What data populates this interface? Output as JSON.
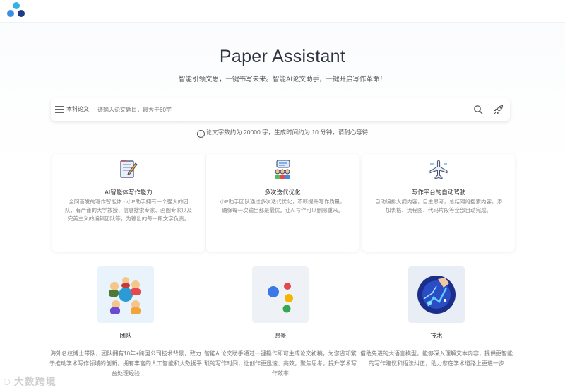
{
  "header": {
    "logo_colors": [
      "#2fb3e8",
      "#3a8ee6",
      "#1f3a8a"
    ]
  },
  "hero": {
    "title": "Paper Assistant",
    "subtitle": "智能引领文思，一键书写未来。智能AI论文助手，一键开启写作革命！"
  },
  "search": {
    "type_label": "本科论文",
    "placeholder": "请输入论文题目，最大于60字",
    "search_icon": "search-icon",
    "submit_icon": "rocket-icon"
  },
  "notice": {
    "icon": "info-icon",
    "text": "论文字数约为 20000 字，生成时间约为 10 分钟，请耐心等待"
  },
  "cards": [
    {
      "icon": "writing-icon",
      "title": "AI智能体写作能力",
      "desc": "全网首发的写作智能体 - 小P助手拥有一个强大的团队，有严谨的大学教授、信息搜索专家、画图专家以及完美主义的编辑团队等，为输出的每一段文字负责。"
    },
    {
      "icon": "team-chat-icon",
      "title": "多次迭代优化",
      "desc": "小P助手团队通过多次迭代优化，不断提升写作质量，确保每一次输出都是最优。让AI写作可以删除重来。"
    },
    {
      "icon": "airplane-icon",
      "title": "写作平台的自动驾驶",
      "desc": "自动编排大纲内容，自主思考，总结网络搜索内容，添加表格、流程图、代码片段等全部自动完成。"
    }
  ],
  "features": [
    {
      "image": "team-illustration",
      "title": "团队",
      "desc": "海外名校博士带队，团队拥有10年+跨国公司技术背景，致力于推动学术写作领域的创新，拥有丰富的人工智能和大数据平台处理经验"
    },
    {
      "image": "vision-dots-illustration",
      "title": "愿景",
      "desc": "智能AI论文助手通过一键操作即可生成论文初稿，为您省却繁琐的写作时间，让创作更迅速、高效，聚焦思考，提升学术写作效率"
    },
    {
      "image": "technology-illustration",
      "title": "技术",
      "desc": "借助先进的大语言模型，能够深入理解文本内容，提供更智能的写作建议和语法纠正，助力您在学术道路上更进一步"
    }
  ],
  "watermark": {
    "text": "大数跨境"
  }
}
